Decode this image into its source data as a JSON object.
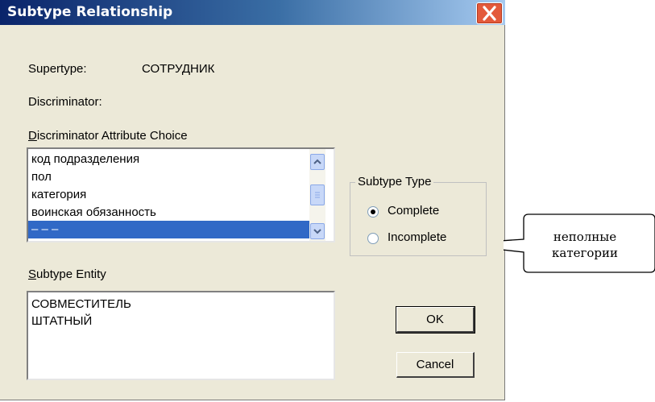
{
  "window": {
    "title": "Subtype Relationship",
    "close_icon": "close-icon",
    "accent_color": "#0a246a"
  },
  "supertype": {
    "label": "Supertype:",
    "value": "СОТРУДНИК"
  },
  "discriminator": {
    "label": "Discriminator:"
  },
  "attribute_choice": {
    "label_mnemonic": "D",
    "label_rest": "iscriminator Attribute Choice",
    "items": [
      {
        "label": "код подразделения"
      },
      {
        "label": "пол"
      },
      {
        "label": "категория"
      },
      {
        "label": "воинская обязанность"
      },
      {
        "label": "– – –",
        "selected": true
      }
    ]
  },
  "subtype_type": {
    "title": "Subtype Type",
    "options": [
      {
        "label": "Complete",
        "checked": true
      },
      {
        "label": "Incomplete",
        "checked": false
      }
    ]
  },
  "subtype_entity": {
    "label_mnemonic": "S",
    "label_rest": "ubtype Entity",
    "items": [
      {
        "label": "СОВМЕСТИТЕЛЬ"
      },
      {
        "label": "ШТАТНЫЙ"
      }
    ]
  },
  "buttons": {
    "ok": "OK",
    "cancel": "Cancel"
  },
  "annotation": {
    "line1": "неполные",
    "line2": "категории"
  }
}
